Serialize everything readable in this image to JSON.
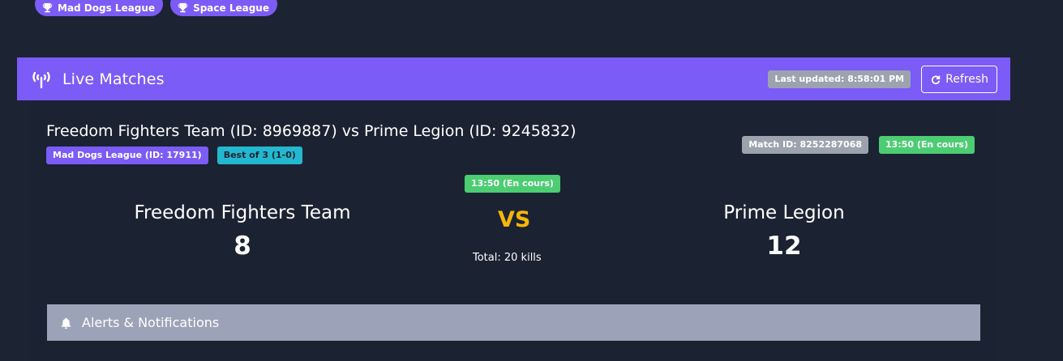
{
  "leagues": [
    {
      "label": "Mad Dogs League",
      "icon": "trophy-icon"
    },
    {
      "label": "Space League",
      "icon": "trophy-icon"
    }
  ],
  "panel": {
    "title": "Live Matches",
    "icon": "antenna-icon",
    "last_updated": "Last updated: 8:58:01 PM",
    "refresh_label": "Refresh",
    "refresh_icon": "refresh-icon",
    "accent_color": "#7b5cf6"
  },
  "match": {
    "title": "Freedom Fighters Team (ID: 8969887) vs Prime Legion (ID: 9245832)",
    "league_tag": "Mad Dogs League (ID: 17911)",
    "series_tag": "Best of 3 (1-0)",
    "match_id": "Match ID: 8252287068",
    "status_top": "13:50 (En cours)",
    "status_center": "13:50 (En cours)",
    "team_left": {
      "name": "Freedom Fighters Team",
      "score": "8"
    },
    "team_right": {
      "name": "Prime Legion",
      "score": "12"
    },
    "vs_label": "VS",
    "total_kills": "Total: 20 kills"
  },
  "alerts": {
    "label": "Alerts & Notifications",
    "icon": "bell-icon"
  },
  "colors": {
    "background": "#1c2333",
    "status_green": "#4ccd72",
    "vs_gold": "#f5b50a",
    "series_cyan": "#22b8cf",
    "muted_gray": "#9ca3af"
  }
}
